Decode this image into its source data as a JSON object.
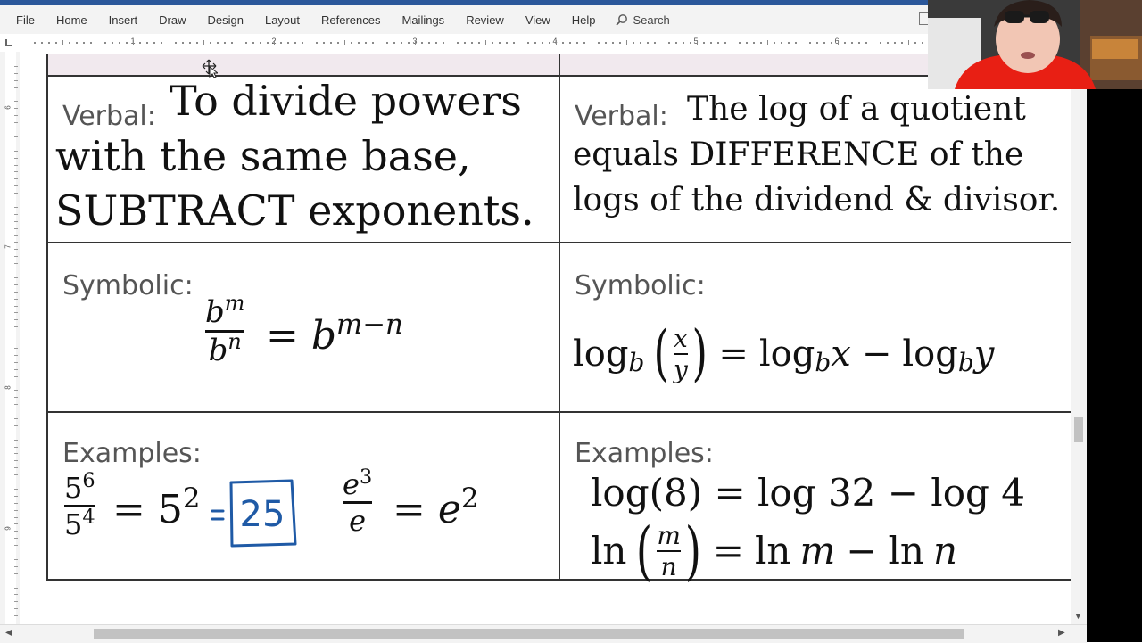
{
  "menu": {
    "items": [
      "File",
      "Home",
      "Insert",
      "Draw",
      "Design",
      "Layout",
      "References",
      "Mailings",
      "Review",
      "View",
      "Help"
    ],
    "search_label": "Search"
  },
  "ruler": {
    "numbers": [
      "1",
      "2",
      "3",
      "4",
      "5",
      "6"
    ],
    "vertical_numbers": [
      "6",
      "7",
      "8",
      "9"
    ]
  },
  "left": {
    "verbal_label": "Verbal:",
    "verbal_lines": [
      "To divide powers",
      "with the same base,",
      "SUBTRACT exponents."
    ],
    "symbolic_label": "Symbolic:",
    "symbolic": {
      "num_base": "b",
      "num_exp": "m",
      "den_base": "b",
      "den_exp": "n",
      "eq": "=",
      "rhs_base": "b",
      "rhs_exp": "m−n"
    },
    "examples_label": "Examples:",
    "example1": {
      "num_base": "5",
      "num_exp": "6",
      "den_base": "5",
      "den_exp": "4",
      "eq": "=",
      "rhs_base": "5",
      "rhs_exp": "2",
      "answer": "25",
      "answer_eq": "="
    },
    "example2": {
      "num_base": "e",
      "num_exp": "3",
      "den": "e",
      "eq": "=",
      "rhs_base": "e",
      "rhs_exp": "2"
    }
  },
  "right": {
    "verbal_label": "Verbal:",
    "verbal_lines": [
      "The log of a quotient",
      "equals DIFFERENCE of the",
      "logs of the dividend & divisor."
    ],
    "symbolic_label": "Symbolic:",
    "symbolic": {
      "log": "log",
      "sub_b": "b",
      "num": "x",
      "den": "y",
      "eq": "=",
      "mid_x": "x",
      "minus": "−",
      "end_y": "y"
    },
    "examples_label": "Examples:",
    "example1": "log(8) = log 32 − log 4",
    "example2": {
      "ln": "ln",
      "num": "m",
      "den": "n",
      "rest_eq": "=",
      "rest_ln1": "ln",
      "rest_m": "m",
      "rest_minus": "−",
      "rest_ln2": "ln",
      "rest_n": "n"
    }
  },
  "colors": {
    "accent": "#2b579a",
    "handwriting": "#1f5aa6",
    "header_tint": "#f1e9ee"
  }
}
